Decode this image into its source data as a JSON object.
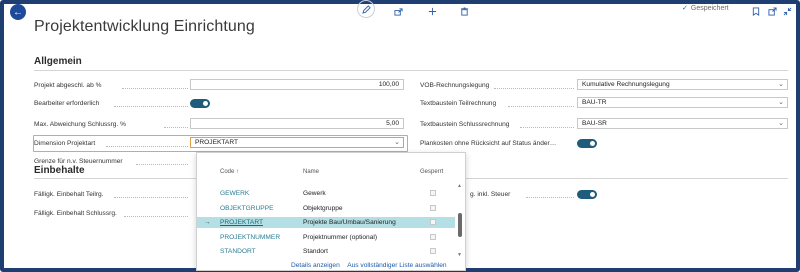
{
  "toolbar": {
    "back_glyph": "←",
    "edit_icon": "pencil-icon",
    "share_icon": "share-icon",
    "new_icon": "plus-icon",
    "delete_icon": "trash-icon",
    "saved_label": "Gespeichert",
    "bookmark_icon": "bookmark-icon",
    "open_new_icon": "open-new-window-icon",
    "collapse_icon": "collapse-icon"
  },
  "page": {
    "title": "Projektentwicklung Einrichtung"
  },
  "allgemein": {
    "title": "Allgemein",
    "left": {
      "projekt_abgeschl_label": "Projekt abgeschl. ab %",
      "projekt_abgeschl_value": "100,00",
      "bearbeiter_label": "Bearbeiter erforderlich",
      "bearbeiter_on": true,
      "max_abweichung_label": "Max. Abweichung Schlussrg. %",
      "max_abweichung_value": "5,00",
      "dimension_label": "Dimension Projektart",
      "dimension_value": "PROJEKTART",
      "grenze_label": "Grenze für n.v. Steuernummer"
    },
    "right": {
      "vob_label": "VOB-Rechnungslegung",
      "vob_value": "Kumulative Rechnungslegung",
      "teilrechnung_label": "Textbaustein Teilrechnung",
      "teilrechnung_value": "BAU-TR",
      "schlussrechnung_label": "Textbaustein Schlussrechnung",
      "schlussrechnung_value": "BAU-SR",
      "plankosten_label": "Plankosten ohne Rücksicht auf Status änder…",
      "plankosten_on": true
    }
  },
  "einbehalte": {
    "title": "Einbehalte",
    "teilrg_label": "Fälligk. Einbehalt Teilrg.",
    "schlussrg_label": "Fälligk. Einbehalt Schlussrg.",
    "steuer_label": "g. inkl. Steuer",
    "steuer_on": true
  },
  "dropdown": {
    "columns": {
      "code": "Code ↑",
      "name": "Name",
      "gesperrt": "Gesperrt"
    },
    "rows": [
      {
        "code": "GEWERK",
        "name": "Gewerk",
        "selected": false
      },
      {
        "code": "OBJEKTGRUPPE",
        "name": "Objektgruppe",
        "selected": false
      },
      {
        "code": "PROJEKTART",
        "name": "Projekte Bau/Umbau/Sanierung",
        "selected": true
      },
      {
        "code": "PROJEKTNUMMER",
        "name": "Projektnummer (optional)",
        "selected": false
      },
      {
        "code": "STANDORT",
        "name": "Standort",
        "selected": false
      }
    ],
    "selected_arrow": "→",
    "details_link": "Details anzeigen",
    "full_list_link": "Aus vollständiger Liste auswählen"
  },
  "colors": {
    "frame": "#1f3f73",
    "toggle": "#1f5b7a",
    "focus": "#e4a557",
    "selected_row": "#b3dfe5",
    "link": "#1e5aa8"
  }
}
